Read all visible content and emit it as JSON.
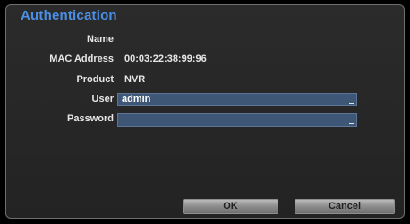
{
  "dialog": {
    "title": "Authentication"
  },
  "fields": {
    "name_label": "Name",
    "name_value": "",
    "mac_label": "MAC Address",
    "mac_value": "00:03:22:38:99:96",
    "product_label": "Product",
    "product_value": "NVR",
    "user_label": "User",
    "user_value": "admin",
    "password_label": "Password",
    "password_value": ""
  },
  "buttons": {
    "ok_label": "OK",
    "cancel_label": "Cancel"
  },
  "colors": {
    "title": "#4b8fe6",
    "input_background": "#3f5777",
    "dialog_background": "#2b2b2b"
  }
}
